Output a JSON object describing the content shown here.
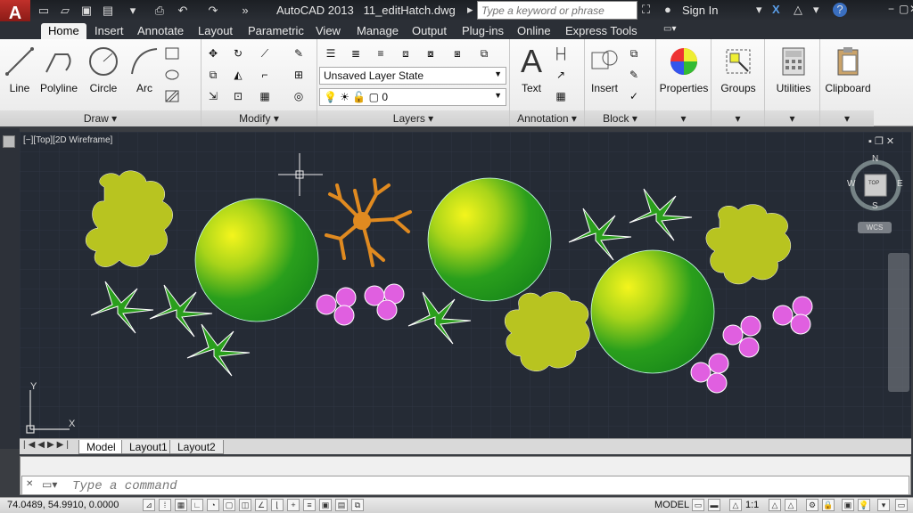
{
  "titlebar": {
    "app_name": "AutoCAD 2013",
    "file_name": "11_editHatch.dwg",
    "search_placeholder": "Type a keyword or phrase",
    "sign_in": "Sign In"
  },
  "ribbon_tabs": [
    "Home",
    "Insert",
    "Annotate",
    "Layout",
    "Parametric",
    "View",
    "Manage",
    "Output",
    "Plug-ins",
    "Online",
    "Express Tools"
  ],
  "draw_panel": {
    "title": "Draw",
    "tools": [
      "Line",
      "Polyline",
      "Circle",
      "Arc"
    ]
  },
  "modify_panel": {
    "title": "Modify"
  },
  "layers_panel": {
    "title": "Layers",
    "layer_state": "Unsaved Layer State",
    "current_layer": "0"
  },
  "annotation_panel": {
    "title": "Annotation",
    "text_tool": "Text"
  },
  "block_panel": {
    "title": "Block",
    "insert_tool": "Insert"
  },
  "properties_panel": {
    "label": "Properties"
  },
  "groups_panel": {
    "label": "Groups"
  },
  "utilities_panel": {
    "label": "Utilities"
  },
  "clipboard_panel": {
    "label": "Clipboard"
  },
  "viewport": {
    "label": "[−][Top][2D Wireframe]",
    "compass": {
      "n": "N",
      "s": "S",
      "e": "E",
      "w": "W",
      "top": "TOP",
      "wcs": "WCS"
    },
    "ucs": {
      "x": "X",
      "y": "Y"
    }
  },
  "layout_tabs": [
    "Model",
    "Layout1",
    "Layout2"
  ],
  "command_line": {
    "placeholder": "Type a command"
  },
  "status": {
    "coords": "74.0489, 54.9910, 0.0000",
    "model": "MODEL",
    "scale": "1:1"
  },
  "colors": {
    "viewport_bg": "#252b35",
    "circle_green": "#1f9a1f",
    "circle_highlight": "#eef020",
    "shrub": "#b8c420",
    "flower": "#e05fe0",
    "tree_orange": "#e08a20"
  }
}
